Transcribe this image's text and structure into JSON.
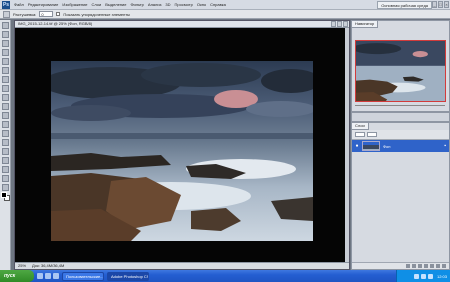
{
  "menu": {
    "logo": "Ps",
    "items": [
      "Файл",
      "Редактирование",
      "Изображение",
      "Слои",
      "Выделение",
      "Фильтр",
      "Анализ",
      "3D",
      "Просмотр",
      "Окно",
      "Справка"
    ],
    "workspace_button": "Основная рабочая среда",
    "controls": [
      "_",
      "□",
      "×"
    ]
  },
  "options_bar": {
    "feather_label": "Растушевка:",
    "feather_value": "0 пикс",
    "checkbox_label": "Показать упорядоченные элементы"
  },
  "document": {
    "title": "IMG_2015-12-14.tif @ 25% (Фон, RGB/8)",
    "zoom": "25%",
    "doc_size": "Док: 36,4M/36,4M"
  },
  "navigator": {
    "tab": "Навигатор"
  },
  "layers": {
    "tab": "Слои",
    "layer_name": "Фон"
  },
  "taskbar": {
    "start": "пуск",
    "tasks": [
      "Пользовательские...",
      "Adobe Photoshop CS..."
    ],
    "clock": "12:03"
  },
  "colors": {
    "accent_selection": "#2f63c9",
    "navigator_frame": "#d23b3b"
  }
}
